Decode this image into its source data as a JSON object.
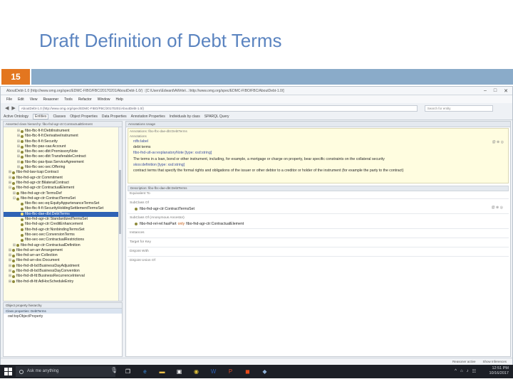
{
  "slide": {
    "title": "Draft Definition of Debt Terms",
    "number": "15"
  },
  "window": {
    "title": "AboutDebt-1.0 (http://www.omg.org/spec/EDMC-FIBO/FBC/20170201/AboutDebt-1.0/) : [C:\\Users\\Edward\\AWrite\\...\\http://www.omg.org/spec/EDMC-FIBO/FBC/AboutDebt-1.0/]",
    "controls": [
      "–",
      "□",
      "✕"
    ]
  },
  "menu": [
    "File",
    "Edit",
    "View",
    "Reasoner",
    "Tools",
    "Refactor",
    "Window",
    "Help"
  ],
  "address": {
    "value": "AboutDebt-1.0 (http://www.omg.org/spec/EDMC-FIBO/FBC/20170201/AboutDebt-1.0/)",
    "search_placeholder": "Search for entity"
  },
  "tabs": [
    "Active Ontology",
    "Entities",
    "Classes",
    "Object Properties",
    "Data Properties",
    "Annotation Properties",
    "Individuals by class",
    "SPARQL Query"
  ],
  "left_panel": {
    "header": "Asserted class hierarchy: fibo-fnd-agr-ctr:ContractualElement",
    "tree": [
      {
        "label": "fibo-fbc-fi-fi:DebtInstrument",
        "indent": 3,
        "expander": "⊞"
      },
      {
        "label": "fibo-fbc-fi-fi:DerivativeInstrument",
        "indent": 3,
        "expander": "⊞"
      },
      {
        "label": "fibo-fbc-fi-fi:Security",
        "indent": 3,
        "expander": "⊞"
      },
      {
        "label": "fibo-fbc-pas-caa:Account",
        "indent": 3,
        "expander": "⊞"
      },
      {
        "label": "fibo-fbc-sec-dbt:PromissoryNote",
        "indent": 3,
        "expander": "⊞"
      },
      {
        "label": "fibo-fbc-sec-dbt:TransferableContract",
        "indent": 3,
        "expander": "⊞"
      },
      {
        "label": "fibo-fbc-pas-fpas:ServiceAgreement",
        "indent": 3,
        "expander": "⊞"
      },
      {
        "label": "fibo-fbc-sec-sec:Offering",
        "indent": 3,
        "expander": "⊞"
      },
      {
        "label": "fibo-fnd-law-lcap:Contract",
        "indent": 1,
        "expander": "⊞"
      },
      {
        "label": "fibo-fnd-agr-ctr:Commitment",
        "indent": 1,
        "expander": "⊞"
      },
      {
        "label": "fibo-fnd-agr-ctr:BilateralContract",
        "indent": 1,
        "expander": "⊞"
      },
      {
        "label": "fibo-fnd-agr-ctr:ContractualElement",
        "indent": 1,
        "expander": "⊟"
      },
      {
        "label": "fibo-fnd-agr-ctr:TermsDef",
        "indent": 2,
        "expander": "⊞"
      },
      {
        "label": "fibo-fnd-agr-ctr:ContractTermsSet",
        "indent": 2,
        "expander": "⊟"
      },
      {
        "label": "fibo-fbc-sec-eq:EquityAppurtenanceTermsSet",
        "indent": 3,
        "expander": ""
      },
      {
        "label": "fibo-fbc-fi-fi:SecurityHoldingSettlementTermsSet",
        "indent": 3,
        "expander": ""
      },
      {
        "label": "fibo-fbc-dae-dbt:DebtTerms",
        "indent": 3,
        "expander": "",
        "selected": true
      },
      {
        "label": "fibo-fnd-agr-ctr:StandardizedTermsSet",
        "indent": 3,
        "expander": ""
      },
      {
        "label": "fibo-fnd-agr-ctr:CreditEnhancement",
        "indent": 3,
        "expander": ""
      },
      {
        "label": "fibo-fnd-agr-ctr:NonbindingTermsSet",
        "indent": 3,
        "expander": ""
      },
      {
        "label": "fibo-sec-sec:ConversionTerms",
        "indent": 3,
        "expander": ""
      },
      {
        "label": "fibo-sec-sec:ContractualRestrictions",
        "indent": 3,
        "expander": ""
      },
      {
        "label": "fibo-fnd-agr-ctr:ContractualDefinition",
        "indent": 2,
        "expander": "⊞"
      },
      {
        "label": "fibo-fnd-arr-arr:Arrangement",
        "indent": 1,
        "expander": "⊞"
      },
      {
        "label": "fibo-fnd-arr-arr:Collection",
        "indent": 1,
        "expander": "⊞"
      },
      {
        "label": "fibo-fnd-arr-doc:Document",
        "indent": 1,
        "expander": "⊞"
      },
      {
        "label": "fibo-fnd-dt-bd:BusinessDayAdjustment",
        "indent": 1,
        "expander": "⊞"
      },
      {
        "label": "fibo-fnd-dt-bd:BusinessDayConvention",
        "indent": 1,
        "expander": "⊞"
      },
      {
        "label": "fibo-fnd-dt-fd:BusinessRecurrenceInterval",
        "indent": 1,
        "expander": "⊞"
      },
      {
        "label": "fibo-fnd-dt-fd:AdHocScheduleEntry",
        "indent": 1,
        "expander": "⊞"
      }
    ]
  },
  "lower_panel": {
    "header": "Object property hierarchy",
    "subheader": "Class properties: DebtTerms",
    "item": "owl:topObjectProperty"
  },
  "annotations": {
    "bar": "Annotations  Usage",
    "header": "Annotations: fibo-fbc-dae-dbt:DebtTerms",
    "section": "Annotations",
    "rows": [
      {
        "text": "rdfs:label",
        "kind": "prop"
      },
      {
        "text": "debt terms",
        "kind": "val"
      },
      {
        "text": "fibo-fnd-utl-av:explanatoryNote  [type: xsd:string]",
        "kind": "prop"
      },
      {
        "text": "The terms in a loan, bond or other instrument, including, for example, a mortgage or charge on property, bear specific constraints on the collateral security",
        "kind": "val"
      },
      {
        "text": "skos:definition  [type: xsd:string]",
        "kind": "prop"
      },
      {
        "text": "contract terms that specify the formal rights and obligations of the issuer or other debtor to a creditor or holder of the instrument (for example the party to the contract)",
        "kind": "val"
      }
    ],
    "icons": [
      "@",
      "⊗",
      "◎"
    ]
  },
  "description": {
    "bar": "Description: fibo-fbc-dae-dbt:DebtTerms",
    "labels": [
      "Equivalent To",
      "SubClass Of",
      "SubClass Of (Anonymous Ancestor)",
      "Instances",
      "Target for Key",
      "Disjoint With",
      "Disjoint Union Of"
    ],
    "subclass_value": "fibo-fnd-agr-ctr:ContractTermsSet",
    "anon_prefix": "fibo-fnd-rel-rel:hasPart",
    "anon_keyword": "only",
    "anon_target": "fibo-fnd-agr-ctr:ContractualElement",
    "icons": [
      "@",
      "⊗",
      "◎"
    ]
  },
  "status": {
    "left": "",
    "right": [
      "Reasoner active",
      "Show Inferences"
    ]
  },
  "taskbar": {
    "search_placeholder": "Ask me anything",
    "apps": [
      "task-view-icon",
      "edge-icon",
      "file-explorer-icon",
      "store-icon",
      "chrome-icon",
      "word-icon",
      "powerpoint-icon",
      "office-icon",
      "protege-icon"
    ],
    "app_glyphs": [
      "❒",
      "e",
      "▬",
      "▣",
      "◉",
      "W",
      "P",
      "◼",
      "◆"
    ],
    "app_colors": [
      "#ffffff",
      "#3b8fe0",
      "#f0c24a",
      "#ffffff",
      "#e3c43a",
      "#2b5fb0",
      "#d24726",
      "#e64a19",
      "#8fb2d8"
    ],
    "time": "12:51 PM",
    "date": "10/16/2017",
    "tray": [
      "^",
      "⌂",
      "♪",
      "☷"
    ]
  }
}
